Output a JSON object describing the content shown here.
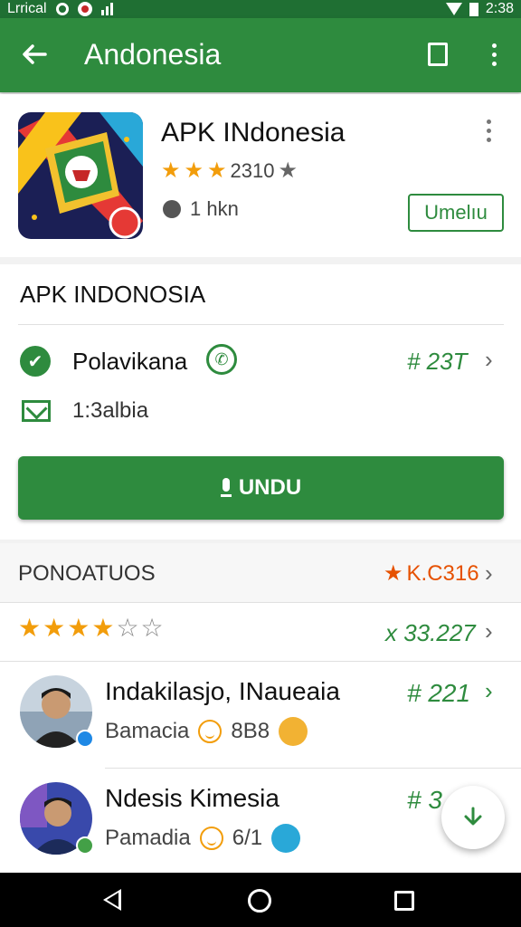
{
  "status_bar": {
    "carrier": "Lrrical",
    "time": "2:38"
  },
  "app_bar": {
    "title": "Andonesia"
  },
  "app_header": {
    "name": "APK INdonesia",
    "rating_text": "2310",
    "meta_text": "1 hkn",
    "action_button": "Umelıu"
  },
  "info": {
    "section_title": "APK INDONOSIA",
    "row1_label": "Polavikana",
    "row1_value": "# 23T",
    "row2_label": "1:3albia",
    "primary_button": "UNDU"
  },
  "reviews": {
    "title": "PONOATUOS",
    "score": "K.C316",
    "stars_value": "x 33.227",
    "items": [
      {
        "name": "Indakilasjo, INaueaia",
        "sub": "Bamacia",
        "count": "8B8",
        "value": "# 221"
      },
      {
        "name": "Ndesis Kimesia",
        "sub": "Pamadia",
        "count": "6/1",
        "value": "# 3"
      }
    ]
  },
  "colors": {
    "primary": "#2e8b3e",
    "primary_dark": "#1f6f33",
    "accent_star": "#f29d0b",
    "score_orange": "#e65100"
  },
  "icons": [
    "back-arrow-icon",
    "square-icon",
    "more-vert-icon",
    "check-badge-icon",
    "phone-icon",
    "mail-icon",
    "mic-icon",
    "chevron-right-icon",
    "download-icon",
    "nav-back-icon",
    "nav-home-icon",
    "nav-recent-icon"
  ]
}
